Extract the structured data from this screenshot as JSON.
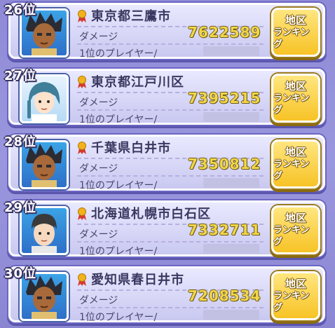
{
  "damage_label": "ダメージ",
  "player_label": "1位のプレイヤー/",
  "button": {
    "line1": "地区",
    "line2": "ランキング"
  },
  "rows": [
    {
      "rank": "26位",
      "region": "東京都三鷹市",
      "damage": "7622589",
      "avatar": "dark-spiky-hair-character"
    },
    {
      "rank": "27位",
      "region": "東京都江戸川区",
      "damage": "7395215",
      "avatar": "blue-braided-hair-character"
    },
    {
      "rank": "28位",
      "region": "千葉県白井市",
      "damage": "7350812",
      "avatar": "dark-spiky-hair-character"
    },
    {
      "rank": "29位",
      "region": "北海道札幌市白石区",
      "damage": "7332711",
      "avatar": "short-hair-character"
    },
    {
      "rank": "30位",
      "region": "愛知県春日井市",
      "damage": "7208534",
      "avatar": "dark-spiky-hair-character"
    }
  ],
  "colors": {
    "background": "#9b97de",
    "card": "#e0dfff",
    "button": "#f7c326",
    "damage_value": "#f2d64a"
  }
}
